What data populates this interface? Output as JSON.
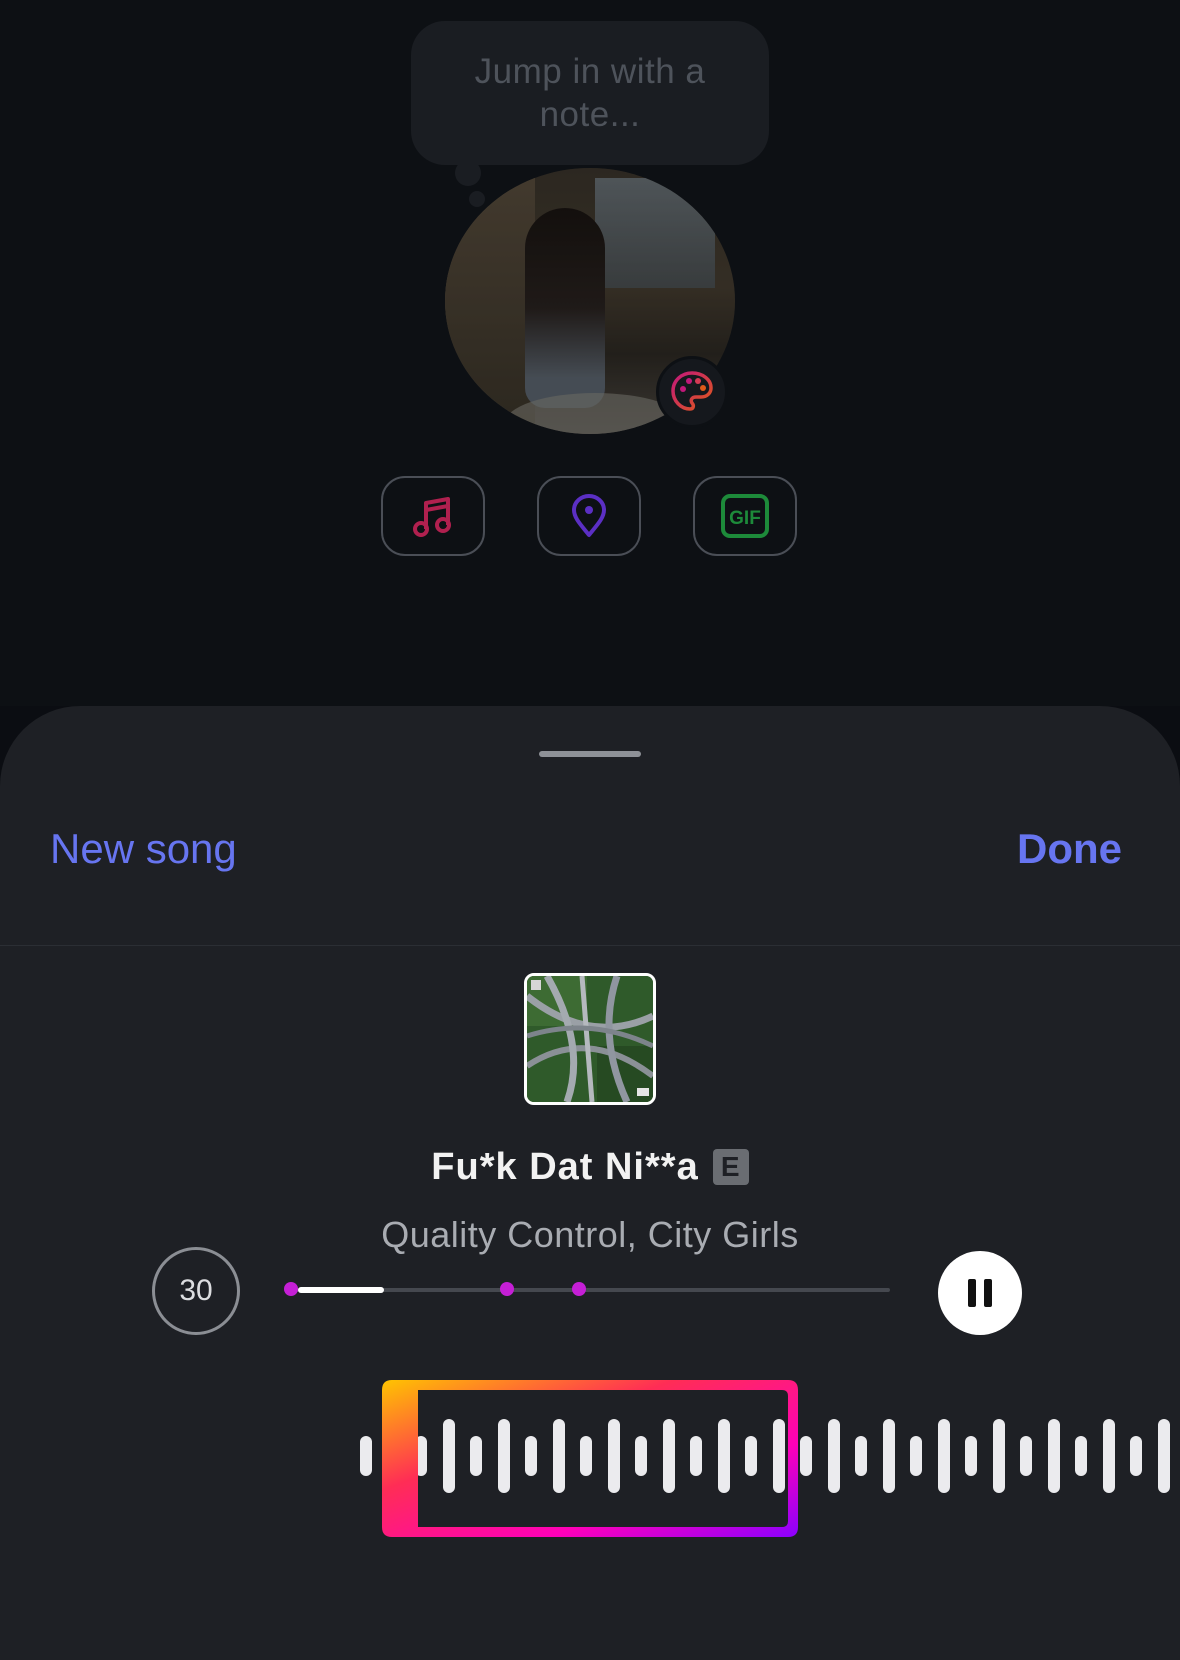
{
  "note": {
    "placeholder": "Jump in with a note..."
  },
  "attachments": [
    {
      "name": "music",
      "icon": "music-note-icon"
    },
    {
      "name": "location",
      "icon": "location-pin-icon"
    },
    {
      "name": "gif",
      "icon": "gif-icon",
      "label": "GIF"
    }
  ],
  "sheet": {
    "new_song_label": "New song",
    "done_label": "Done"
  },
  "song": {
    "title": "Fu*k Dat Ni**a",
    "explicit_badge": "E",
    "artists": "Quality Control, City Girls"
  },
  "player": {
    "clip_duration": "30",
    "progress_fraction": 0.16,
    "markers_fraction": [
      0.0,
      0.36,
      0.48
    ],
    "state": "playing"
  },
  "colors": {
    "accent": "#6775f0",
    "marker": "#c51fd6",
    "selector_gradient": [
      "#ffc400",
      "#ff2d55",
      "#ff00b8",
      "#8b00ff"
    ]
  }
}
